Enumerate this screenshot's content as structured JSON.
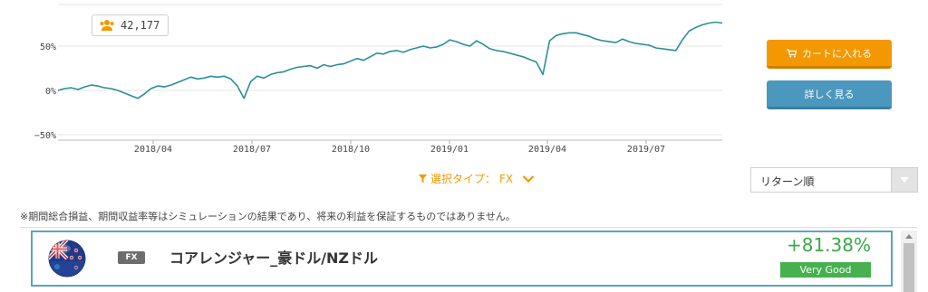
{
  "chart_data": {
    "type": "line",
    "xlabel": "",
    "ylabel": "",
    "x_tick_labels": [
      "2018/04",
      "2018/07",
      "2018/10",
      "2019/01",
      "2019/04",
      "2019/07"
    ],
    "y_tick_labels": [
      "50%",
      "0%",
      "−50%"
    ],
    "ylim": [
      -50,
      90
    ],
    "grid": true,
    "color": "#2a8f99",
    "series": [
      {
        "values": [
          0,
          2,
          3,
          1,
          4,
          6,
          5,
          3,
          2,
          0,
          -3,
          -6,
          -9,
          -4,
          2,
          5,
          4,
          6,
          9,
          12,
          15,
          13,
          14,
          16,
          15,
          16,
          13,
          5,
          -9,
          10,
          16,
          14,
          18,
          20,
          21,
          24,
          26,
          27,
          28,
          25,
          29,
          27,
          29,
          30,
          33,
          36,
          34,
          38,
          42,
          41,
          44,
          45,
          43,
          46,
          48,
          50,
          48,
          49,
          52,
          57,
          55,
          52,
          50,
          56,
          52,
          47,
          45,
          44,
          42,
          40,
          38,
          35,
          32,
          18,
          56,
          62,
          64,
          65,
          65,
          63,
          61,
          58,
          56,
          55,
          54,
          58,
          55,
          53,
          52,
          51,
          48,
          47,
          46,
          45,
          57,
          67,
          71,
          74,
          76,
          77,
          76
        ]
      }
    ]
  },
  "users": {
    "icon": "users-icon",
    "count": "42,177"
  },
  "buttons": {
    "cart": "カートに入れる",
    "detail": "詳しく見る"
  },
  "filter": {
    "label": "選択タイプ：",
    "value": "FX"
  },
  "sort": {
    "selected": "リターン順"
  },
  "disclaimer": "※期間総合損益、期間収益率等はシミュレーションの結果であり、将来の利益を保証するものではありません。",
  "strategy": {
    "type": "FX",
    "name": "コアレンジャー_豪ドル/NZドル",
    "return": "+81.38%",
    "rating": "Very Good"
  },
  "colors": {
    "accent": "#f39800",
    "blue_button": "#4c97be",
    "line": "#2a8f99",
    "positive": "#3aa94a"
  }
}
